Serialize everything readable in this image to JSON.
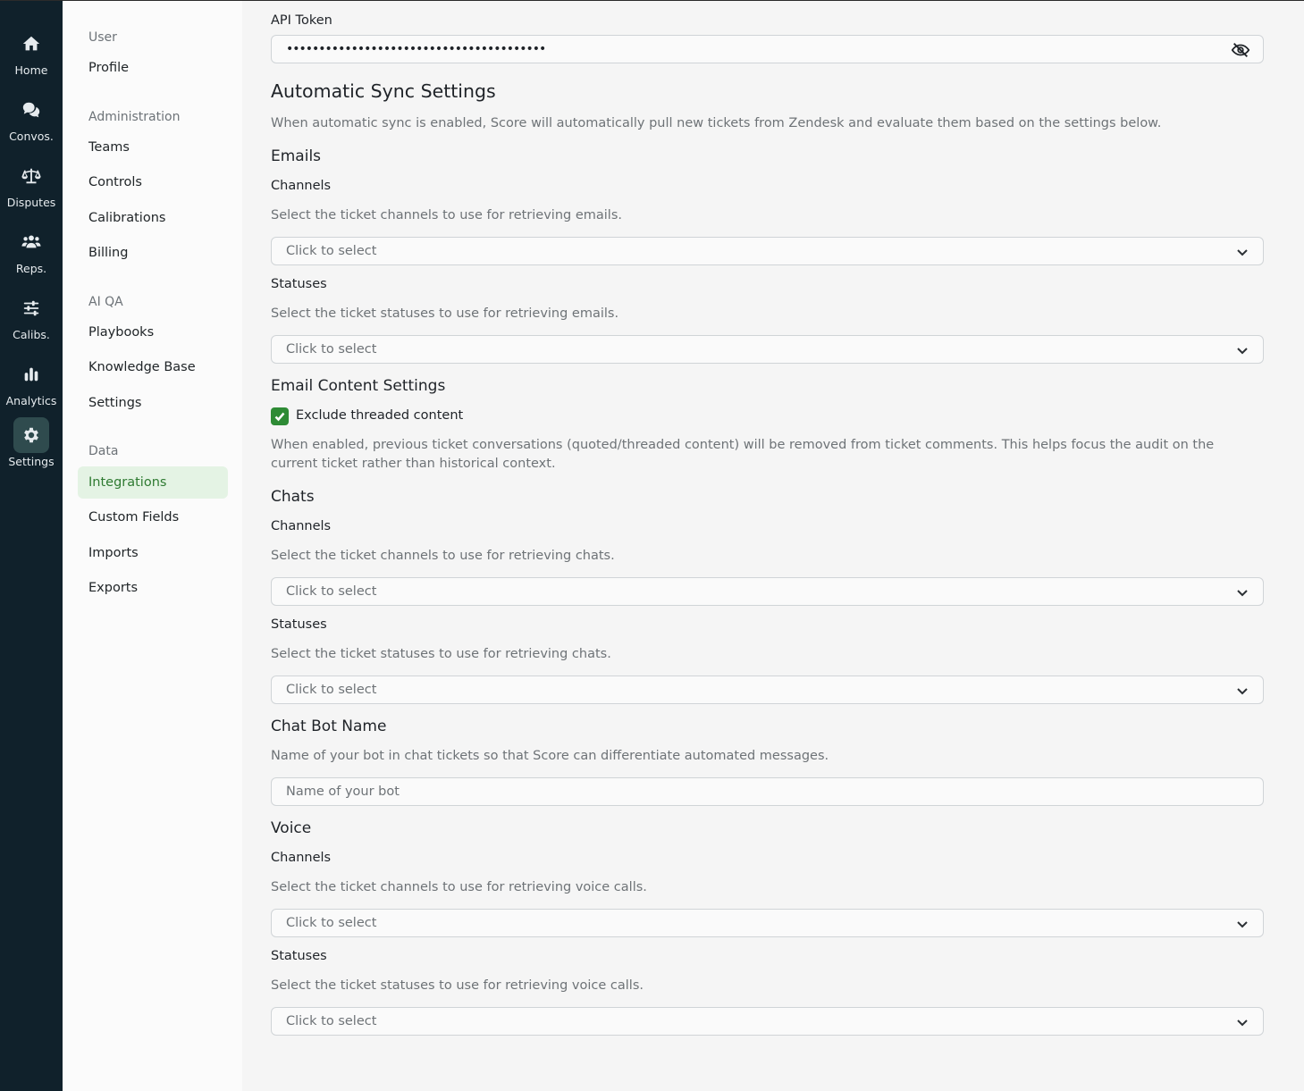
{
  "rail": {
    "items": [
      {
        "label": "Home",
        "icon": "home-icon"
      },
      {
        "label": "Convos.",
        "icon": "chat-icon"
      },
      {
        "label": "Disputes",
        "icon": "scale-icon"
      },
      {
        "label": "Reps.",
        "icon": "users-icon"
      },
      {
        "label": "Calibs.",
        "icon": "sliders-icon"
      },
      {
        "label": "Analytics",
        "icon": "bar-chart-icon"
      },
      {
        "label": "Settings",
        "icon": "gear-icon"
      }
    ],
    "active": "Settings"
  },
  "subnav": {
    "groups": [
      "User",
      "Administration",
      "AI QA",
      "Data"
    ],
    "items": [
      "Profile",
      "Teams",
      "Controls",
      "Calibrations",
      "Billing",
      "Playbooks",
      "Knowledge Base",
      "Settings",
      "Integrations",
      "Custom Fields",
      "Imports",
      "Exports"
    ],
    "active": "Integrations"
  },
  "main": {
    "api_token_label": "API Token",
    "api_token_value": "••••••••••••••••••••••••••••••••••••••••",
    "sync_title": "Automatic Sync Settings",
    "sync_description": "When automatic sync is enabled, Score will automatically pull new tickets from Zendesk and evaluate them based on the settings below.",
    "emails": {
      "title": "Emails",
      "channels_label": "Channels",
      "channels_help": "Select the ticket channels to use for retrieving emails.",
      "channels_placeholder": "Click to select",
      "statuses_label": "Statuses",
      "statuses_help": "Select the ticket statuses to use for retrieving emails.",
      "statuses_placeholder": "Click to select"
    },
    "email_content": {
      "title": "Email Content Settings",
      "checkbox_label": "Exclude threaded content",
      "checked": true,
      "help": "When enabled, previous ticket conversations (quoted/threaded content) will be removed from ticket comments. This helps focus the audit on the current ticket rather than historical context."
    },
    "chats": {
      "title": "Chats",
      "channels_label": "Channels",
      "channels_help": "Select the ticket channels to use for retrieving chats.",
      "channels_placeholder": "Click to select",
      "statuses_label": "Statuses",
      "statuses_help": "Select the ticket statuses to use for retrieving chats.",
      "statuses_placeholder": "Click to select"
    },
    "chat_bot": {
      "title": "Chat Bot Name",
      "help": "Name of your bot in chat tickets so that Score can differentiate automated messages.",
      "placeholder": "Name of your bot"
    },
    "voice": {
      "title": "Voice",
      "channels_label": "Channels",
      "channels_help": "Select the ticket channels to use for retrieving voice calls.",
      "channels_placeholder": "Click to select",
      "statuses_label": "Statuses",
      "statuses_help": "Select the ticket statuses to use for retrieving voice calls.",
      "statuses_placeholder": "Click to select"
    }
  }
}
